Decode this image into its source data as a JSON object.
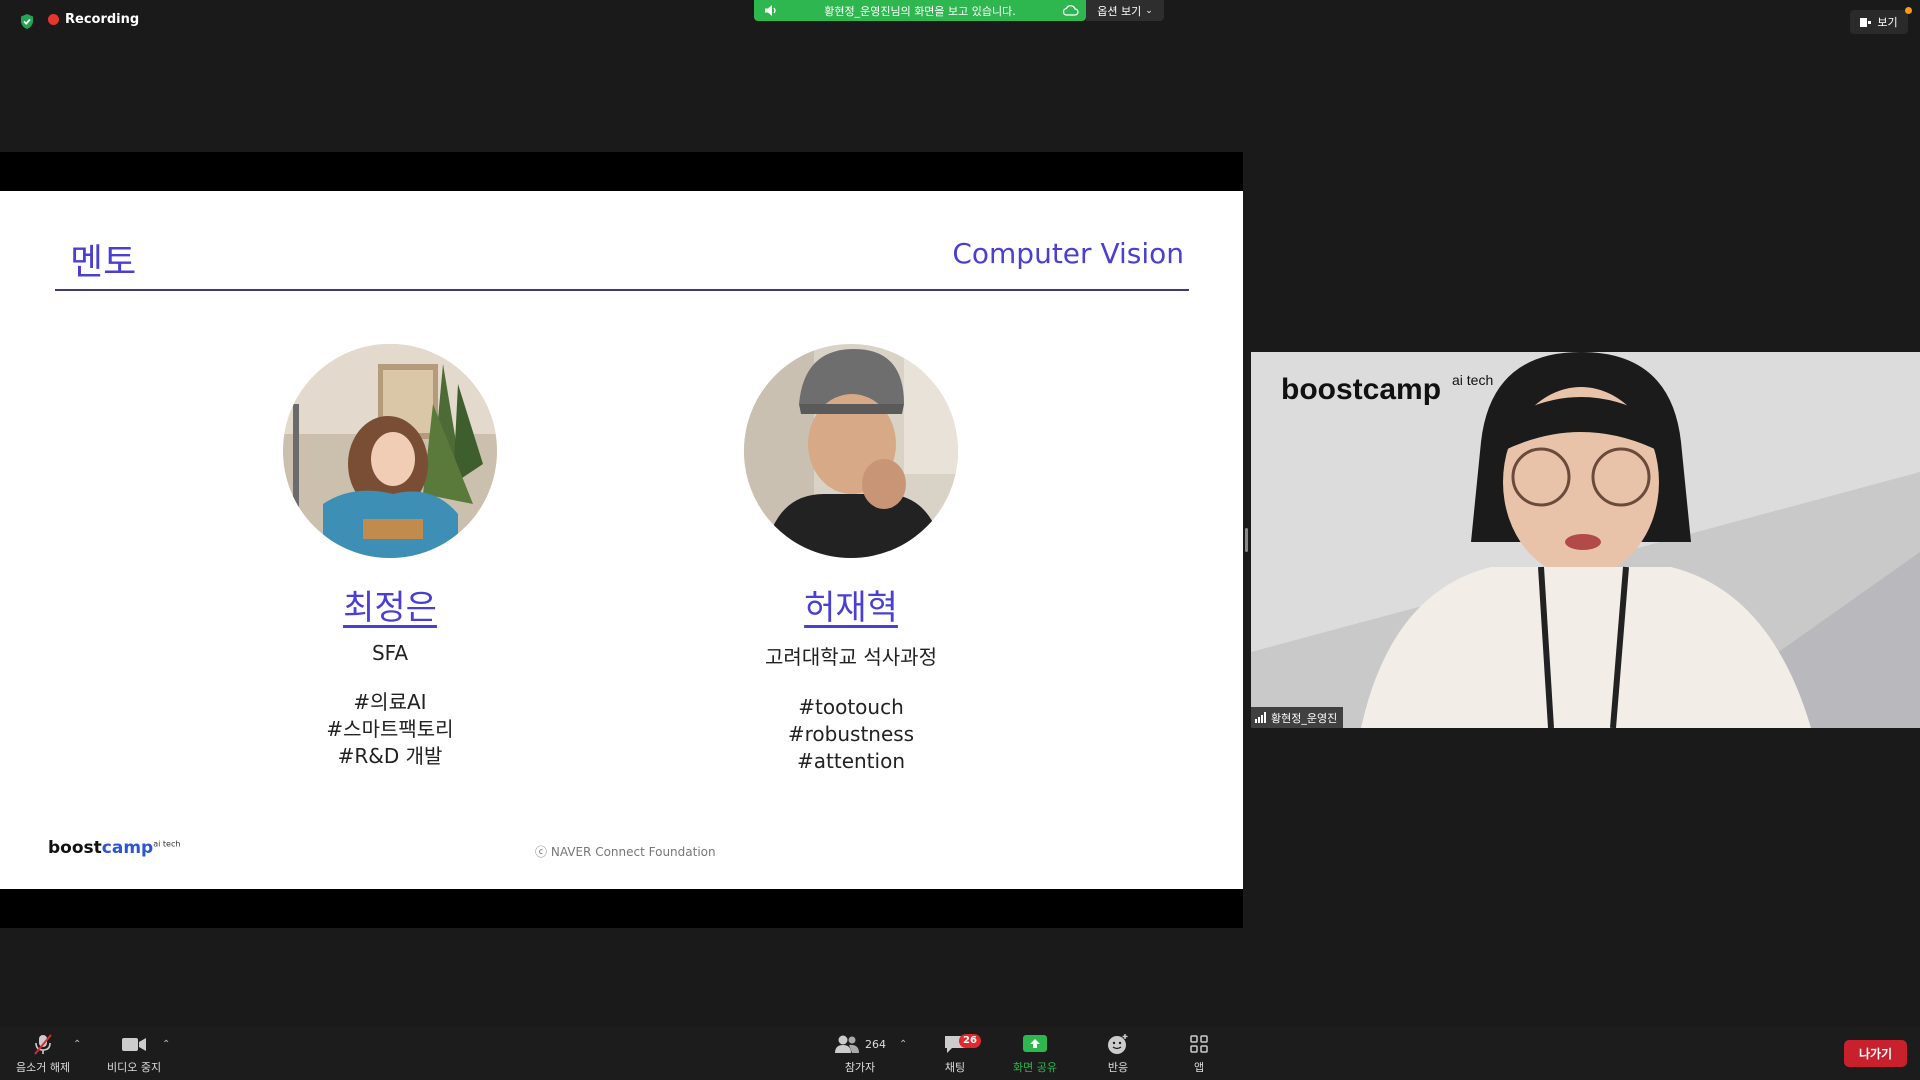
{
  "topbar": {
    "recording_label": "Recording",
    "share_banner_text": "황현정_운영진님의 화면을 보고 있습니다.",
    "view_options_label": "옵션 보기",
    "view_label": "보기"
  },
  "slide": {
    "title": "멘토",
    "topic": "Computer Vision",
    "mentors": [
      {
        "name": "최정은",
        "org": "SFA",
        "tags": [
          "#의료AI",
          "#스마트팩토리",
          "#R&D 개발"
        ]
      },
      {
        "name": "허재혁",
        "org": "고려대학교 석사과정",
        "tags": [
          "#tootouch",
          "#robustness",
          "#attention"
        ]
      }
    ],
    "footer_logo_prefix": "boost",
    "footer_logo_suffix": "camp",
    "footer_logo_sup": "ai tech",
    "footer_copyright": "NAVER Connect Foundation"
  },
  "speaker": {
    "name": "황현정_운영진",
    "background_logo_prefix": "boostcamp",
    "background_logo_sup": "ai tech"
  },
  "toolbar": {
    "unmute_label": "음소거 해제",
    "stop_video_label": "비디오 중지",
    "participants_label": "참가자",
    "participants_count": "264",
    "chat_label": "채팅",
    "chat_badge": "26",
    "share_screen_label": "화면 공유",
    "reactions_label": "반응",
    "apps_label": "앱",
    "leave_label": "나가기"
  },
  "colors": {
    "accent_purple": "#4a3fd3",
    "share_green": "#2db74e",
    "leave_red": "#c8202c",
    "recording_red": "#e8352b"
  }
}
